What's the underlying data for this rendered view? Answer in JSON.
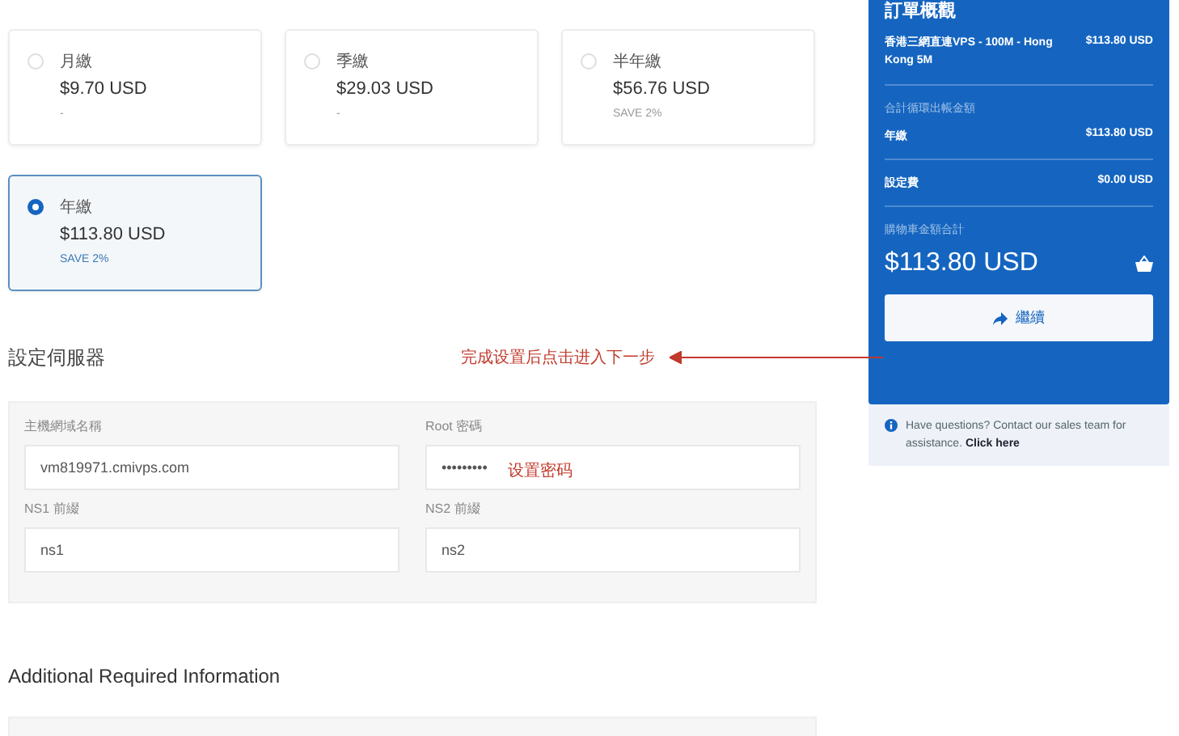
{
  "billing_cycles": [
    {
      "label": "月繳",
      "price": "$9.70 USD",
      "note": "-",
      "selected": false
    },
    {
      "label": "季繳",
      "price": "$29.03 USD",
      "note": "-",
      "selected": false
    },
    {
      "label": "半年繳",
      "price": "$56.76 USD",
      "note": "SAVE 2%",
      "selected": false
    },
    {
      "label": "年繳",
      "price": "$113.80 USD",
      "note": "SAVE 2%",
      "selected": true
    }
  ],
  "server_config": {
    "title": "設定伺服器",
    "fields": [
      {
        "label": "主機網域名稱",
        "value": "vm819971.cmivps.com"
      },
      {
        "label": "Root 密碼",
        "value": "•••••••••"
      },
      {
        "label": "NS1 前綴",
        "value": "ns1"
      },
      {
        "label": "NS2 前綴",
        "value": "ns2"
      }
    ]
  },
  "annotations": {
    "next_step": "完成设置后点击进入下一步",
    "password": "设置密码"
  },
  "additional_title": "Additional Required Information",
  "order_summary": {
    "title": "訂單概觀",
    "product": "香港三網直連VPS - 100M - Hong Kong 5M",
    "product_price": "$113.80 USD",
    "recurring_label": "合計循環出帳金額",
    "lines": [
      {
        "label": "年繳",
        "value": "$113.80 USD"
      },
      {
        "label": "設定費",
        "value": "$0.00 USD"
      }
    ],
    "total_label": "購物車金額合計",
    "total": "$113.80 USD",
    "button": "繼續"
  },
  "help": {
    "text": "Have questions? Contact our sales team for assistance.",
    "link": "Click here"
  }
}
